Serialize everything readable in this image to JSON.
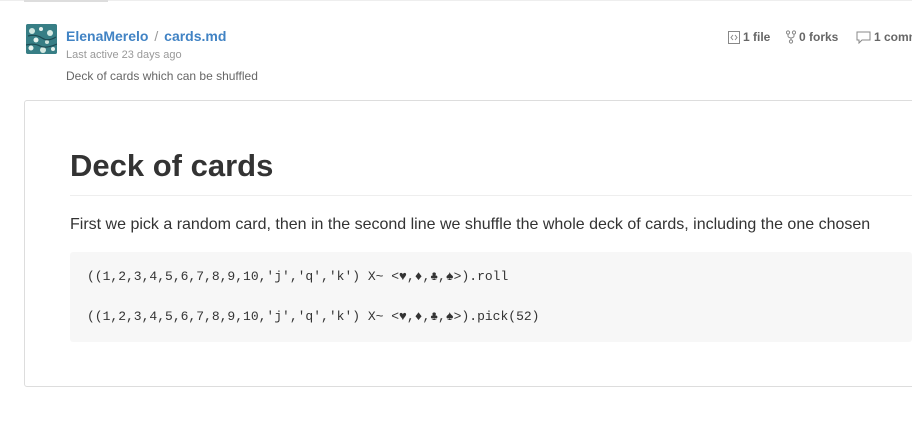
{
  "header": {
    "owner": "ElenaMerelo",
    "separator": "/",
    "filename": "cards.md",
    "last_active": "Last active 23 days ago",
    "description": "Deck of cards which can be shuffled",
    "avatar_icon": "avatar-image"
  },
  "stats": {
    "files_label": "1 file",
    "forks_label": "0 forks",
    "comments_label": "1 comm",
    "files_icon": "code-file-icon",
    "forks_icon": "fork-icon",
    "comments_icon": "comment-icon"
  },
  "document": {
    "title": "Deck of cards",
    "paragraph": "First we pick a random card, then in the second line we shuffle the whole deck of cards, including the one chosen",
    "code_lines": [
      "((1,2,3,4,5,6,7,8,9,10,'j','q','k') X~ <♥,♦,♣,♠>).roll",
      "((1,2,3,4,5,6,7,8,9,10,'j','q','k') X~ <♥,♦,♣,♠>).pick(52)"
    ]
  },
  "colors": {
    "link": "#4183c4",
    "muted": "#999999",
    "text": "#333333",
    "code_bg": "#f7f7f7",
    "border": "#dddddd"
  }
}
